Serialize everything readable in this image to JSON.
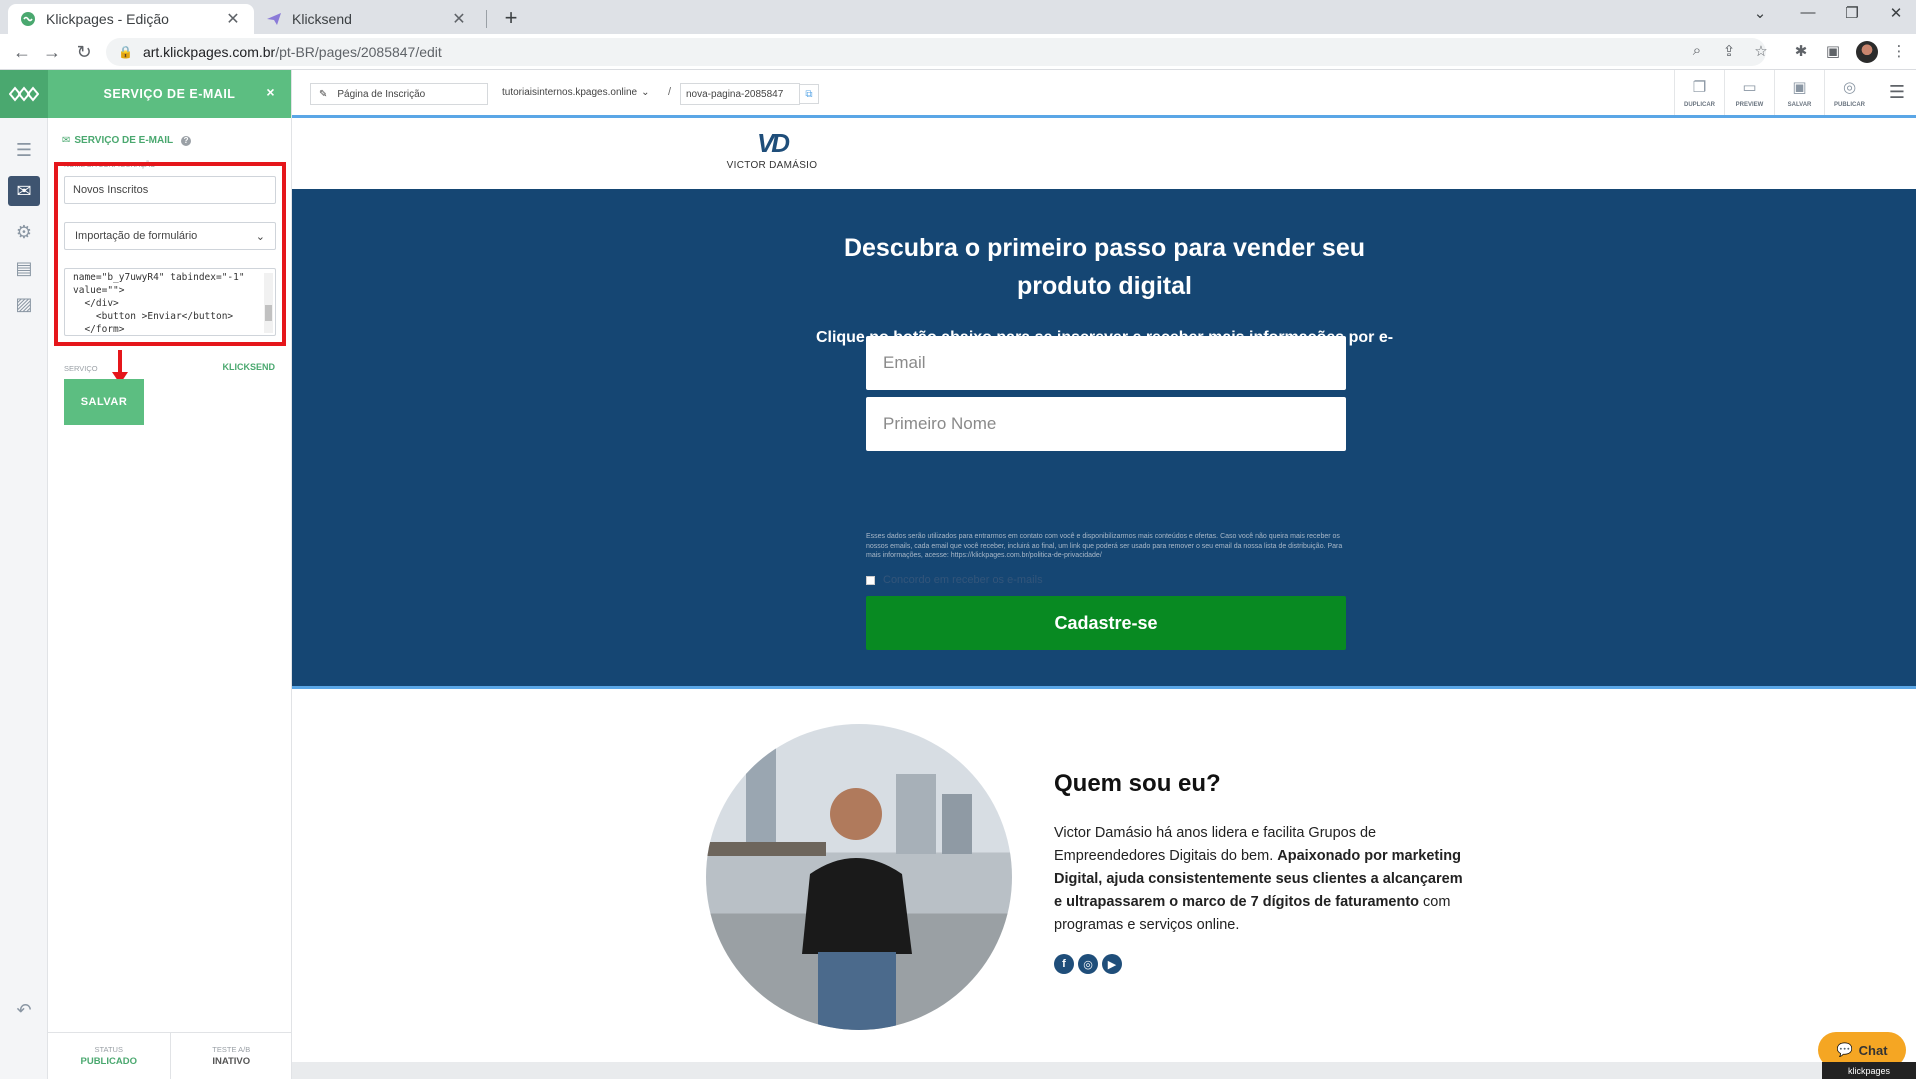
{
  "browser": {
    "tabs": [
      {
        "title": "Klickpages - Edição",
        "active": true
      },
      {
        "title": "Klicksend",
        "active": false
      }
    ],
    "url_host": "art.klickpages.com.br",
    "url_path": "/pt-BR/pages/2085847/edit"
  },
  "panel": {
    "header": "SERVIÇO DE E-MAIL",
    "close": "×",
    "section_title": "SERVIÇO DE E-MAIL",
    "config_label": "NOME DA CONFIGURAÇÃO",
    "config_value": "Novos Inscritos",
    "type_select": "Importação de formulário",
    "code_lines": "name=\"b_y7uwyR4\" tabindex=\"-1\"\nvalue=\"\">\n  </div>\n    <button >Enviar</button>\n  </form>",
    "service_label": "SERVIÇO",
    "service_value": "KLICKSEND",
    "save": "SALVAR",
    "status_label": "STATUS",
    "status_value": "PUBLICADO",
    "ab_label": "TESTE A/B",
    "ab_value": "INATIVO"
  },
  "editor": {
    "page_name": "Página de Inscrição",
    "domain": "tutoriaisinternos.kpages.online",
    "slug": "nova-pagina-2085847",
    "actions": [
      "DUPLICAR",
      "PREVIEW",
      "SALVAR",
      "PUBLICAR"
    ]
  },
  "page": {
    "logo_mark": "VD",
    "logo_name": "VICTOR DAMÁSIO",
    "hero_title": "Descubra o primeiro passo para vender seu produto digital",
    "hero_sub": "Clique no botão abaixo para se inscrever e receber mais informações por e-mail sobre como lucrar no digital.",
    "email_placeholder": "Email",
    "name_placeholder": "Primeiro Nome",
    "disclaimer": "Esses dados serão utilizados para entrarmos em contato com você e disponibilizarmos mais conteúdos e ofertas. Caso você não queira mais receber os nossos emails, cada email que você receber, incluirá ao final, um link que poderá ser usado para remover o seu email da nossa lista de distribuição. Para mais informações, acesse: https://klickpages.com.br/politica-de-privacidade/",
    "consent": "Concordo em receber os e-mails",
    "cta": "Cadastre-se",
    "about_title": "Quem sou eu?",
    "bio_plain": "Victor Damásio há anos lidera e facilita Grupos de Empreendedores Digitais do bem. ",
    "bio_bold_1": "Apaixonado por marketing Digital, ajuda consistentemente seus clientes a alcançarem e ultrapassarem o marco de 7 dígitos de faturamento",
    "bio_tail": " com programas e serviços online.",
    "chat": "Chat",
    "badge": "klickpages"
  },
  "colors": {
    "accent": "#5cbe81",
    "hero_bg": "#154673",
    "cta": "#088a22",
    "highlight": "#e5161b"
  }
}
